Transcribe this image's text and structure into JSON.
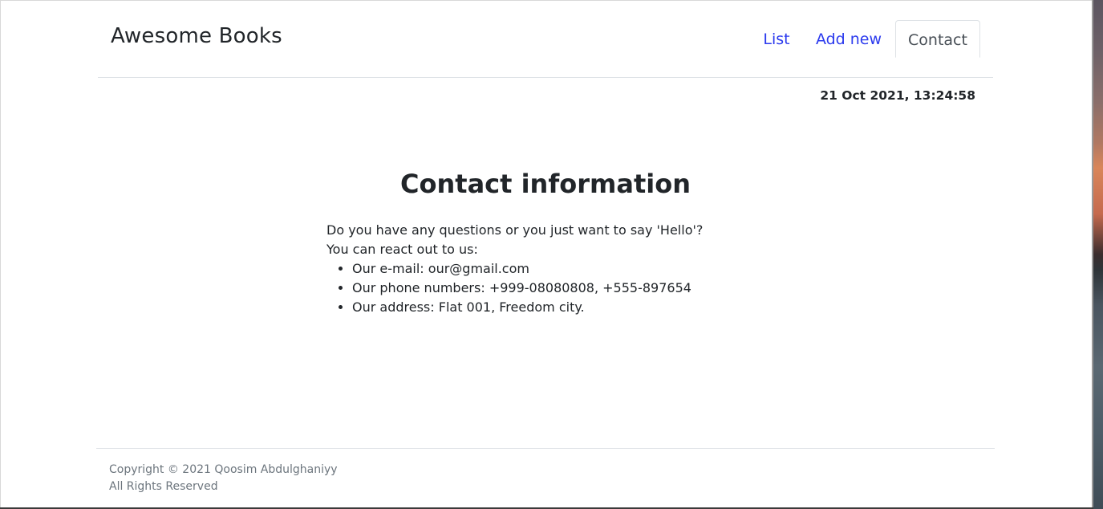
{
  "brand": "Awesome Books",
  "nav": {
    "items": [
      {
        "label": "List"
      },
      {
        "label": "Add new"
      },
      {
        "label": "Contact"
      }
    ],
    "active": "Contact"
  },
  "datetime": "21 Oct 2021, 13:24:58",
  "contact": {
    "title": "Contact information",
    "intro_1": "Do you have any questions or you just want to say 'Hello'?",
    "intro_2": "You can react out to us:",
    "items": [
      "Our e-mail: our@gmail.com",
      "Our phone numbers: +999-08080808, +555-897654",
      "Our address: Flat 001, Freedom city."
    ]
  },
  "footer": {
    "copyright": "Copyright © 2021 Qoosim Abdulghaniyy",
    "rights": "All Rights Reserved"
  },
  "colors": {
    "link": "#2b3aee",
    "text": "#212529",
    "muted": "#6c757d",
    "border": "#dee2e6"
  }
}
